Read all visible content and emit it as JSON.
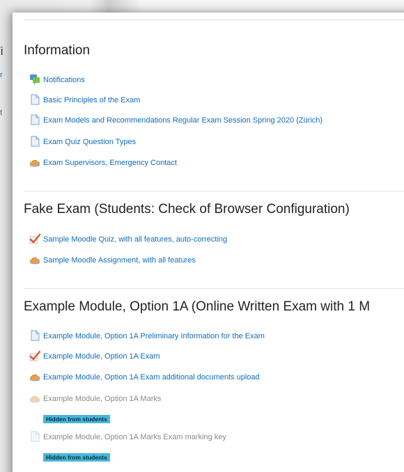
{
  "background_window": {
    "partial_title": "/i",
    "partial_link_1": "r",
    "partial_link_2": "t"
  },
  "sections": [
    {
      "title": "Information",
      "activities": [
        {
          "label": "Notifications",
          "icon": "forum-icon",
          "hidden": false
        },
        {
          "label": "Basic Principles of the Exam",
          "icon": "file-icon",
          "hidden": false
        },
        {
          "label": "Exam Models and Recommendations Regular Exam Session Spring 2020 (Zürich)",
          "icon": "file-icon",
          "hidden": false
        },
        {
          "label": "Exam Quiz Question Types",
          "icon": "file-icon",
          "hidden": false
        },
        {
          "label": "Exam Supervisors, Emergency Contact",
          "icon": "assignment-icon",
          "hidden": false
        }
      ]
    },
    {
      "title": "Fake Exam (Students: Check of Browser Configuration)",
      "activities": [
        {
          "label": "Sample Moodle Quiz, with all features, auto-correcting",
          "icon": "quiz-icon",
          "hidden": false
        },
        {
          "label": "Sample Moodle Assignment, with all features",
          "icon": "assignment-icon",
          "hidden": false
        }
      ]
    },
    {
      "title": "Example Module, Option 1A (Online Written Exam with 1 M",
      "activities": [
        {
          "label": "Example Module, Option 1A Preliminary Information for the Exam",
          "icon": "file-icon",
          "hidden": false
        },
        {
          "label": "Example Module, Option 1A Exam",
          "icon": "quiz-icon",
          "hidden": false
        },
        {
          "label": "Example Module, Option 1A Exam additional documents upload",
          "icon": "assignment-icon",
          "hidden": false
        },
        {
          "label": "Example Module, Option 1A Marks",
          "icon": "assignment-icon",
          "hidden": true,
          "badge": "Hidden from students"
        },
        {
          "label": "Example Module, Option 1A Marks Exam marking key",
          "icon": "file-icon",
          "hidden": true,
          "badge": "Hidden from students"
        }
      ]
    }
  ],
  "colors": {
    "link": "#0f6cbf",
    "dimmed": "#8a8a8a",
    "badge_bg": "#46b8da",
    "heading": "#1d2125"
  }
}
